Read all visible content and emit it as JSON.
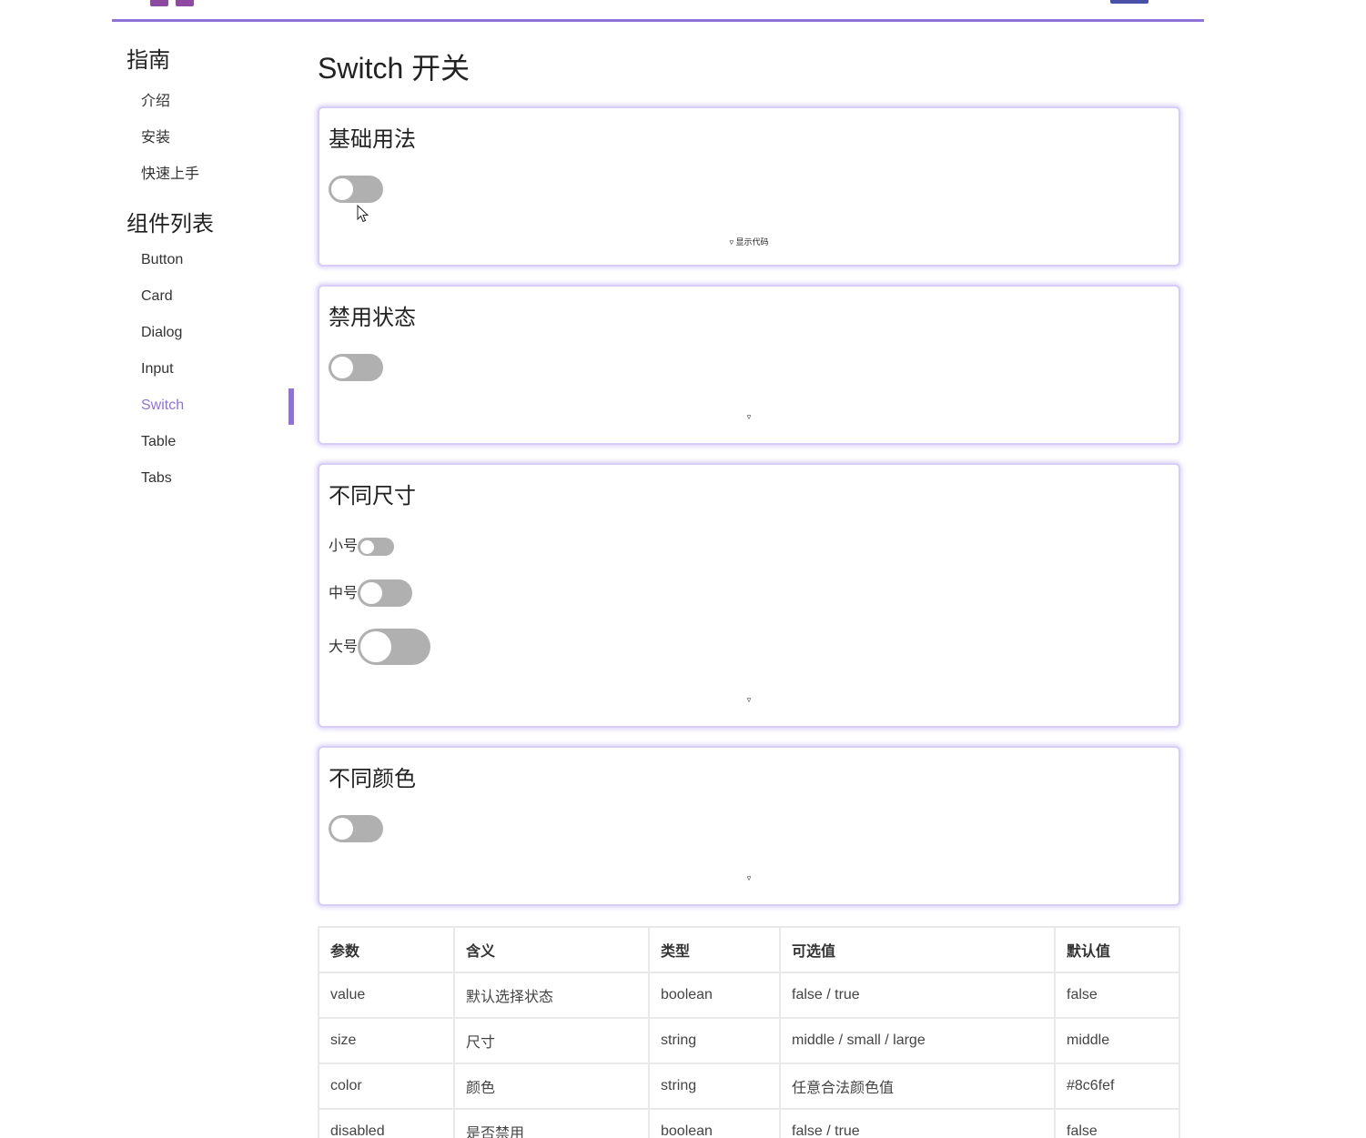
{
  "header": {
    "logo_icon": "logo-icon"
  },
  "sidebar": {
    "guide_heading": "指南",
    "guide_items": [
      "介绍",
      "安装",
      "快速上手"
    ],
    "components_heading": "组件列表",
    "component_items": [
      "Button",
      "Card",
      "Dialog",
      "Input",
      "Switch",
      "Table",
      "Tabs"
    ],
    "active_item": "Switch"
  },
  "main": {
    "title": "Switch 开关",
    "sections": [
      {
        "title": "基础用法",
        "toggle_code": "▿ 显示代码"
      },
      {
        "title": "禁用状态",
        "toggle_code": "▿"
      },
      {
        "title": "不同尺寸",
        "toggle_code": "▿",
        "size_labels": [
          "小号",
          "中号",
          "大号"
        ]
      },
      {
        "title": "不同颜色",
        "toggle_code": "▿"
      }
    ]
  },
  "api_table": {
    "headers": [
      "参数",
      "含义",
      "类型",
      "可选值",
      "默认值"
    ],
    "rows": [
      [
        "value",
        "默认选择状态",
        "boolean",
        "false / true",
        "false"
      ],
      [
        "size",
        "尺寸",
        "string",
        "middle / small / large",
        "middle"
      ],
      [
        "color",
        "颜色",
        "string",
        "任意合法颜色值",
        "#8c6fef"
      ],
      [
        "disabled",
        "是否禁用",
        "boolean",
        "false / true",
        "false"
      ]
    ]
  },
  "colors": {
    "accent": "#8f72d9",
    "switch_off": "#b0b0b0",
    "logo": "#8d4aa0",
    "top_button": "#4a50a8"
  }
}
